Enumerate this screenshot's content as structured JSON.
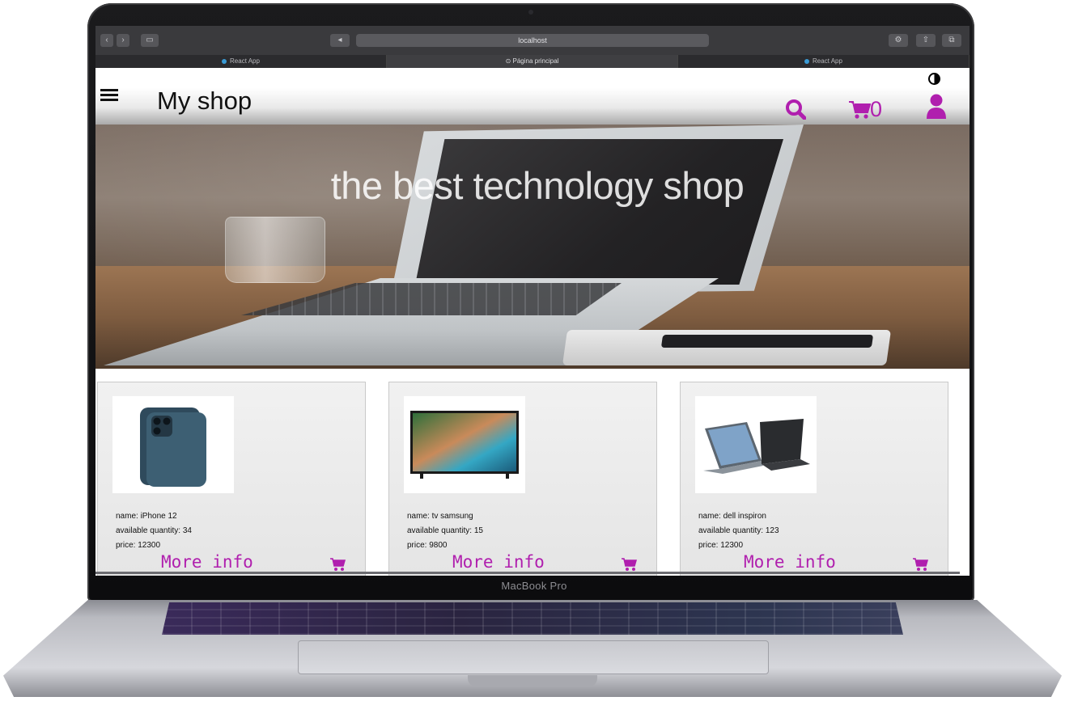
{
  "browser": {
    "url": "localhost",
    "tabs": [
      "React App",
      "Página principal",
      "React App"
    ]
  },
  "header": {
    "brand": "My shop",
    "cart_count": "0"
  },
  "hero": {
    "title": "the best technology shop"
  },
  "products": [
    {
      "name": "name: iPhone 12",
      "quantity": "available quantity: 34",
      "price": "price: 12300",
      "more_info": "More info",
      "image_icon": "phone-image"
    },
    {
      "name": "name: tv samsung",
      "quantity": "available quantity: 15",
      "price": "price: 9800",
      "more_info": "More info",
      "image_icon": "tv-image"
    },
    {
      "name": "name: dell inspiron",
      "quantity": "available quantity: 123",
      "price": "price: 12300",
      "more_info": "More info",
      "image_icon": "laptop-image"
    }
  ],
  "device": {
    "label": "MacBook Pro"
  },
  "colors": {
    "accent": "#b01fae",
    "header_bg": "#ffffff",
    "card_bg": "#e9e9e9"
  },
  "icons": [
    "menu-icon",
    "contrast-icon",
    "search-icon",
    "cart-icon",
    "user-icon",
    "add-to-cart-icon"
  ]
}
